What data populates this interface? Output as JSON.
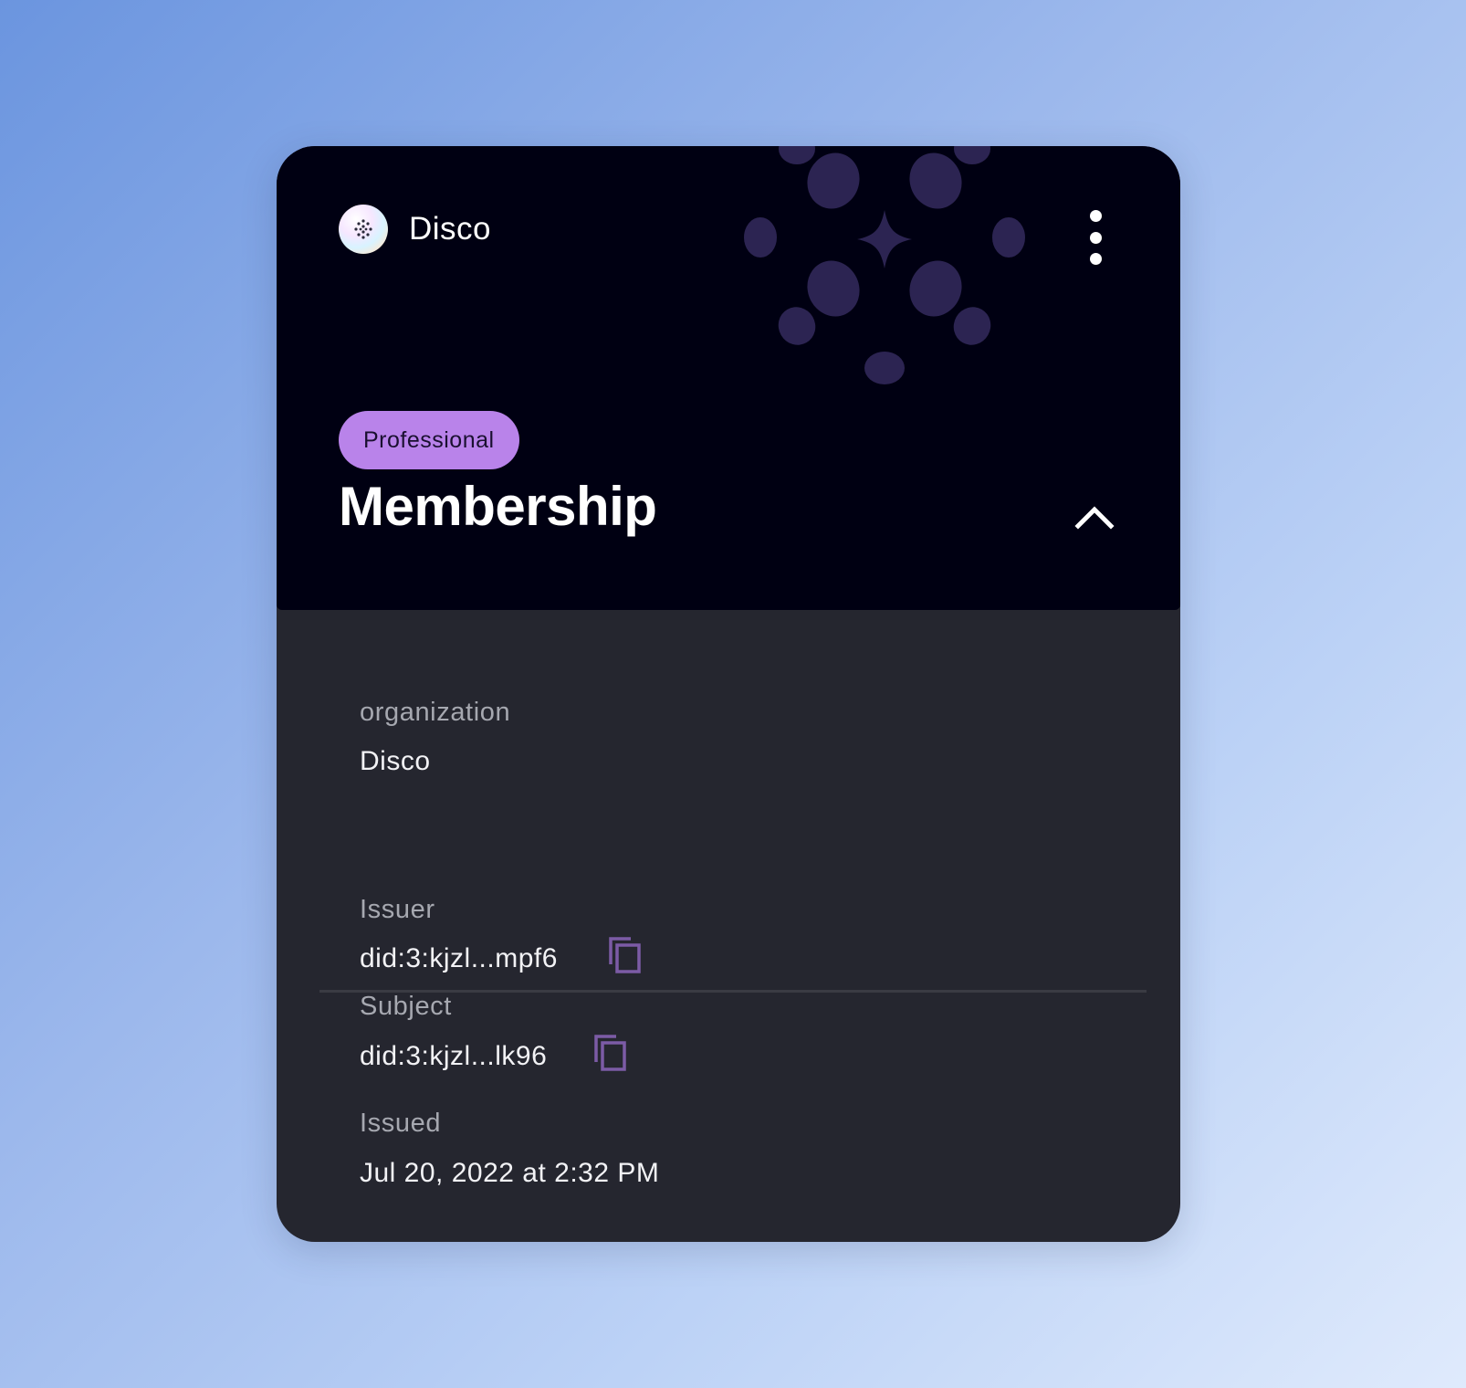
{
  "card": {
    "brand": {
      "name": "Disco",
      "logo_icon": "disco-logo-icon"
    },
    "menu_icon": "vertical-ellipsis-icon",
    "badge": "Professional",
    "title": "Membership",
    "collapse_icon": "chevron-up-icon",
    "decoration_icon": "sparkle-pattern-icon",
    "colors": {
      "header_bg": "#000012",
      "body_bg": "#25262f",
      "badge_bg": "#b983ea",
      "pattern": "#2c2452",
      "copy_icon": "#7c5ba6"
    }
  },
  "fields": {
    "organization": {
      "label": "organization",
      "value": "Disco"
    },
    "issuer": {
      "label": "Issuer",
      "value": "did:3:kjzl...mpf6",
      "copy_icon": "copy-icon"
    },
    "subject": {
      "label": "Subject",
      "value": "did:3:kjzl...lk96",
      "copy_icon": "copy-icon"
    },
    "issued": {
      "label": "Issued",
      "value": "Jul 20, 2022 at 2:32 PM"
    }
  }
}
